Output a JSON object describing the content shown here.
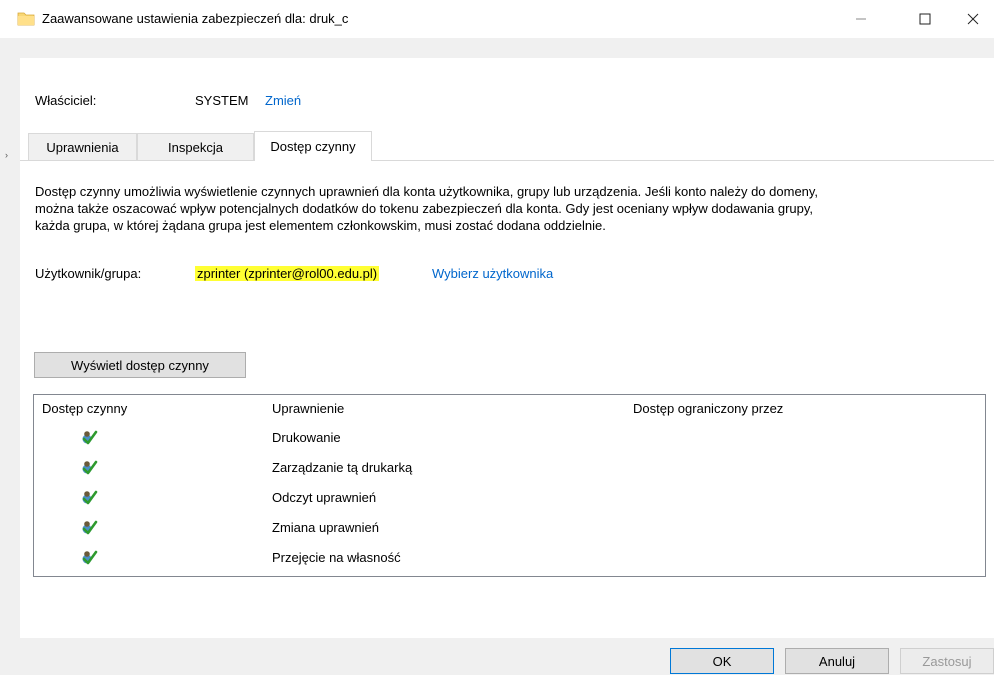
{
  "window": {
    "title": "Zaawansowane ustawienia zabezpieczeń dla: druk_c",
    "icon": "folder-icon",
    "controls": {
      "minimize": "—",
      "maximize": "☐",
      "close": "✕"
    }
  },
  "owner": {
    "label": "Właściciel:",
    "value": "SYSTEM",
    "change_link": "Zmień"
  },
  "tabs": [
    {
      "label": "Uprawnienia",
      "active": false
    },
    {
      "label": "Inspekcja",
      "active": false
    },
    {
      "label": "Dostęp czynny",
      "active": true
    }
  ],
  "description": [
    "Dostęp czynny umożliwia wyświetlenie czynnych uprawnień dla konta użytkownika, grupy lub urządzenia. Jeśli konto należy do domeny,",
    "można także oszacować wpływ potencjalnych dodatków do tokenu zabezpieczeń dla konta. Gdy jest oceniany wpływ dodawania grupy,",
    "każda grupa, w której żądana grupa jest elementem członkowskim, musi zostać dodana oddzielnie."
  ],
  "user_group": {
    "label": "Użytkownik/grupa:",
    "value": "zprinter (zprinter@rol00.edu.pl)",
    "select_link": "Wybierz użytkownika",
    "highlight_color": "#ffff33"
  },
  "view_button": "Wyświetl dostęp czynny",
  "table": {
    "columns": [
      "Dostęp czynny",
      "Uprawnienie",
      "Dostęp ograniczony przez"
    ],
    "rows": [
      {
        "icon": "effective-access-granted-icon",
        "permission": "Drukowanie",
        "limited_by": ""
      },
      {
        "icon": "effective-access-granted-icon",
        "permission": "Zarządzanie tą drukarką",
        "limited_by": ""
      },
      {
        "icon": "effective-access-granted-icon",
        "permission": "Odczyt uprawnień",
        "limited_by": ""
      },
      {
        "icon": "effective-access-granted-icon",
        "permission": "Zmiana uprawnień",
        "limited_by": ""
      },
      {
        "icon": "effective-access-granted-icon",
        "permission": "Przejęcie na własność",
        "limited_by": ""
      }
    ]
  },
  "footer": {
    "ok": "OK",
    "cancel": "Anuluj",
    "apply": "Zastosuj"
  },
  "colors": {
    "link": "#0066cc",
    "accent": "#0078d7"
  }
}
